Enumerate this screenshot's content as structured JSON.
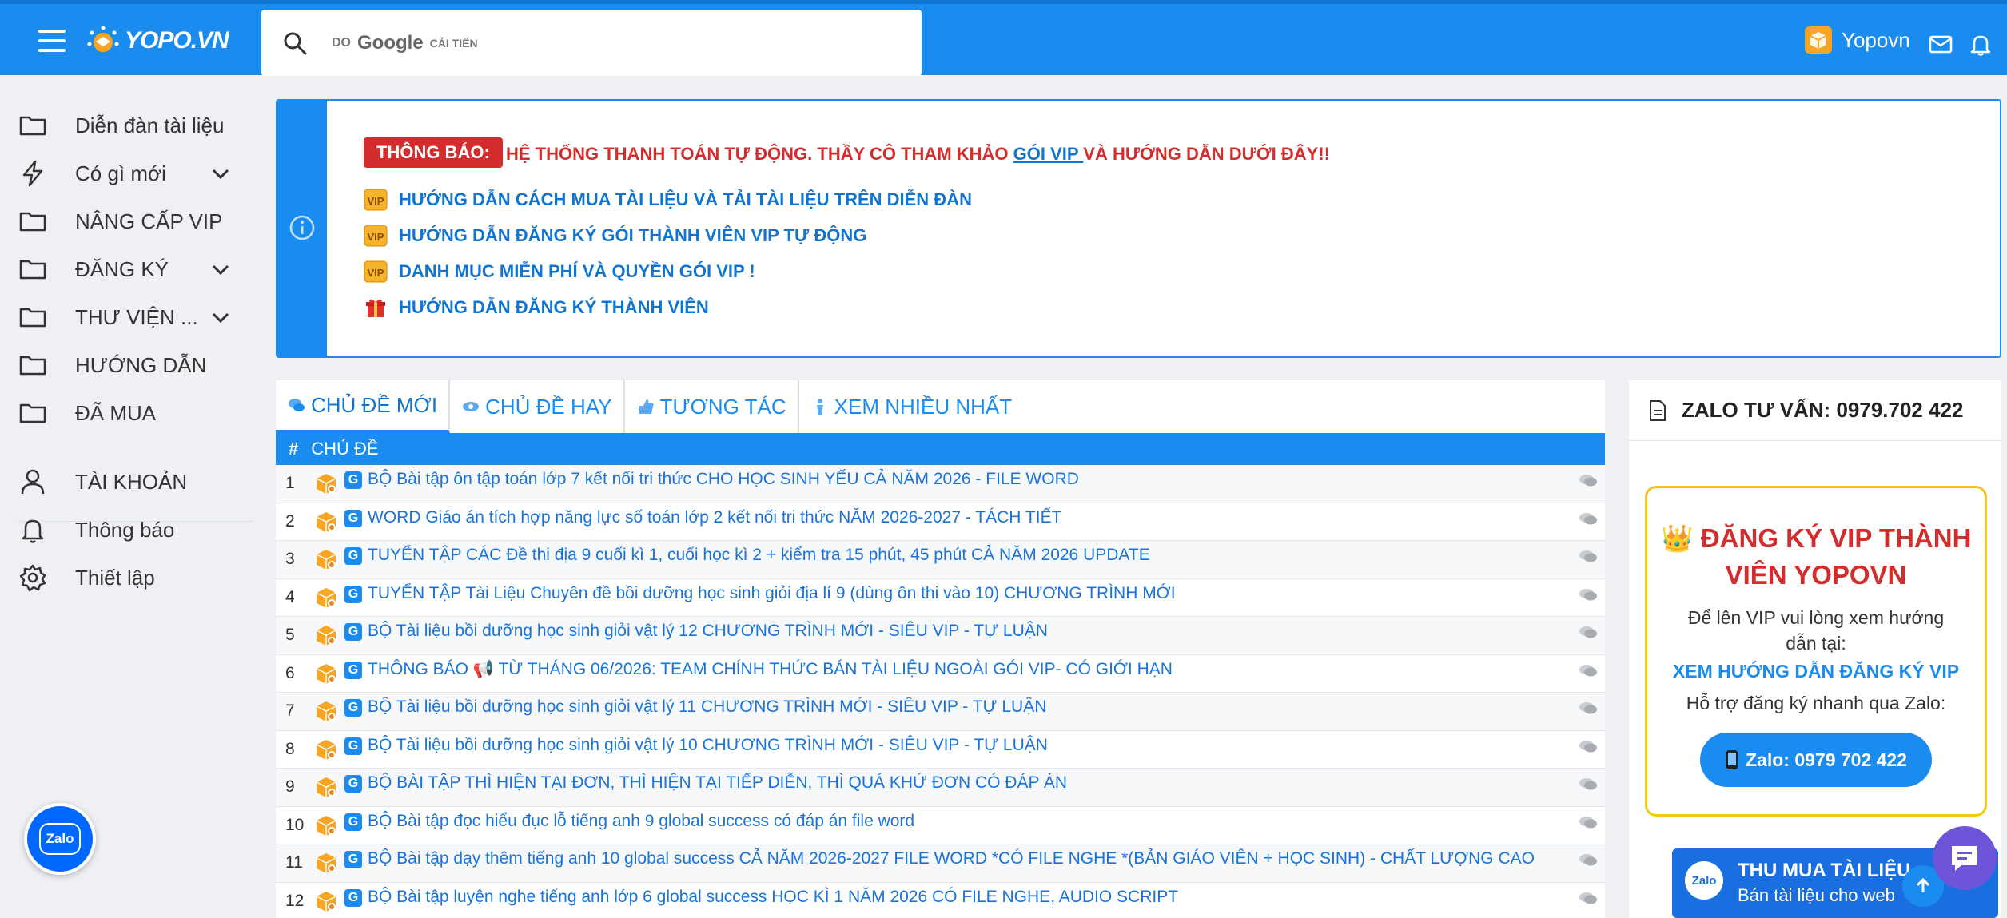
{
  "header": {
    "logo_text": "YOPO.VN",
    "search_by": "DO",
    "search_brand": "Google",
    "search_suffix": "CẢI TIẾN",
    "username": "Yopovn"
  },
  "sidebar": {
    "items": [
      {
        "label": "Diễn đàn tài liệu",
        "icon": "folder-icon"
      },
      {
        "label": "Có gì mới",
        "icon": "lightning-icon"
      },
      {
        "label": "NÂNG CẤP VIP",
        "icon": "folder-icon"
      },
      {
        "label": "ĐĂNG KÝ",
        "icon": "folder-icon"
      },
      {
        "label": "THƯ VIỆN ...",
        "icon": "folder-icon"
      },
      {
        "label": "HƯỚNG DẪN",
        "icon": "folder-icon"
      },
      {
        "label": "ĐÃ MUA",
        "icon": "folder-icon"
      },
      {
        "label": "TÀI KHOẢN",
        "icon": "user-icon"
      },
      {
        "label": "Thông báo",
        "icon": "bell-icon"
      },
      {
        "label": "Thiết lập",
        "icon": "gear-icon"
      }
    ]
  },
  "notice": {
    "badge": "THÔNG BÁO:",
    "message_before": "HỆ THỐNG THANH TOÁN TỰ ĐỘNG. THẦY CÔ THAM KHẢO ",
    "message_link": "GÓI VIP ",
    "message_after": "VÀ HƯỚNG DẪN DƯỚI ĐÂY!!",
    "lines": [
      "HƯỚNG DẪN CÁCH MUA TÀI LIỆU VÀ TẢI TÀI LIỆU TRÊN DIỄN ĐÀN",
      "HƯỚNG DẪN ĐĂNG KÝ GÓI THÀNH VIÊN VIP TỰ ĐỘNG",
      "DANH MỤC MIỄN PHÍ VÀ QUYỀN GÓI VIP !",
      "HƯỚNG DẪN ĐĂNG KÝ THÀNH VIÊN"
    ]
  },
  "tabs": [
    "CHỦ ĐỀ MỚI",
    "CHỦ ĐỀ HAY",
    "TƯƠNG TÁC",
    "XEM NHIỀU NHẤT"
  ],
  "table": {
    "hash": "#",
    "col": "CHỦ ĐỀ",
    "rows": [
      {
        "n": "1",
        "title": "BỘ Bài tập ôn tập toán lớp 7 kết nối tri thức CHO HỌC SINH YẾU CẢ NĂM 2026 - FILE WORD"
      },
      {
        "n": "2",
        "title": "WORD Giáo án tích hợp năng lực số toán lớp 2 kết nối tri thức NĂM 2026-2027 - TÁCH TIẾT"
      },
      {
        "n": "3",
        "title": "TUYỂN TẬP CÁC Đề thi địa 9 cuối kì 1, cuối học kì 2 + kiểm tra 15 phút, 45 phút CẢ NĂM 2026 UPDATE"
      },
      {
        "n": "4",
        "title": "TUYỂN TẬP Tài Liệu Chuyên đề bồi dưỡng học sinh giỏi địa lí 9 (dùng ôn thi vào 10) CHƯƠNG TRÌNH MỚI"
      },
      {
        "n": "5",
        "title": "BỘ Tài liệu bồi dưỡng học sinh giỏi vật lý 12 CHƯƠNG TRÌNH MỚI - SIÊU VIP - TỰ LUẬN"
      },
      {
        "n": "6",
        "title": "THÔNG BÁO 📢 TỪ THÁNG 06/2026: TEAM CHÍNH THỨC BÁN TÀI LIỆU NGOÀI GÓI VIP- CÓ GIỚI HẠN"
      },
      {
        "n": "7",
        "title": "BỘ Tài liệu bồi dưỡng học sinh giỏi vật lý 11 CHƯƠNG TRÌNH MỚI - SIÊU VIP - TỰ LUẬN"
      },
      {
        "n": "8",
        "title": "BỘ Tài liệu bồi dưỡng học sinh giỏi vật lý 10 CHƯƠNG TRÌNH MỚI - SIÊU VIP - TỰ LUẬN"
      },
      {
        "n": "9",
        "title": "BỘ BÀI TẬP THÌ HIỆN TẠI ĐƠN, THÌ HIỆN TẠI TIẾP DIỄN, THÌ QUÁ KHỨ ĐƠN CÓ ĐÁP ÁN"
      },
      {
        "n": "10",
        "title": "BỘ Bài tập đọc hiểu đục lỗ tiếng anh 9 global success có đáp án file word"
      },
      {
        "n": "11",
        "title": "BỘ Bài tập dạy thêm tiếng anh 10 global success CẢ NĂM 2026-2027 FILE WORD *CÓ FILE NGHE *(BẢN GIÁO VIÊN + HỌC SINH) - CHẤT LƯỢNG CAO"
      },
      {
        "n": "12",
        "title": "BỘ Bài tập luyện nghe tiếng anh lớp 6 global success HỌC KÌ 1 NĂM 2026 CÓ FILE NGHE, AUDIO SCRIPT"
      }
    ]
  },
  "right": {
    "heading": "ZALO TƯ VẤN: 0979.702 422",
    "vip_title": "👑 ĐĂNG KÝ VIP THÀNH VIÊN YOPOVN",
    "vip_desc": "Để lên VIP vui lòng xem hướng dẫn tại:",
    "vip_link": "XEM HƯỚNG DẪN ĐĂNG KÝ VIP",
    "vip_support": "Hỗ trợ đăng ký nhanh qua Zalo:",
    "vip_button": "Zalo: 0979 702 422",
    "banner_title": "THU MUA TÀI LIỆU",
    "banner_sub": "Bán tài liệu cho web",
    "banner_logo": "Zalo"
  },
  "floating": {
    "zalo": "Zalo"
  },
  "colors": {
    "primary": "#1a8cf0",
    "alert": "#d42c2c",
    "link": "#1a73d8",
    "gold": "#f5c518"
  }
}
